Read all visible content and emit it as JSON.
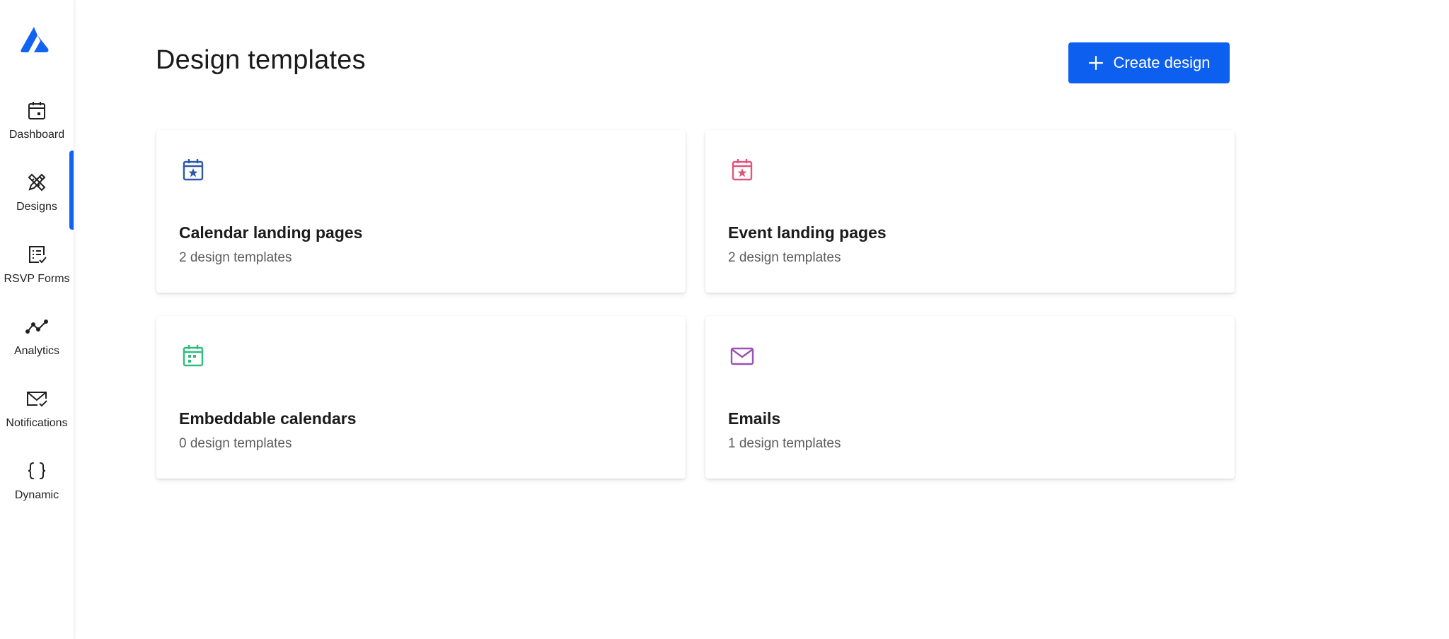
{
  "sidebar": {
    "logo_icon": "brand-logo",
    "active_color": "#1263f1",
    "items": [
      {
        "label": "Dashboard",
        "icon": "calendar-icon"
      },
      {
        "label": "Designs",
        "icon": "design-tools-icon"
      },
      {
        "label": "RSVP Forms",
        "icon": "form-check-icon"
      },
      {
        "label": "Analytics",
        "icon": "line-chart-icon"
      },
      {
        "label": "Notifications",
        "icon": "mail-check-icon"
      },
      {
        "label": "Dynamic",
        "icon": "curly-braces-icon"
      }
    ],
    "active_item": "Designs"
  },
  "header": {
    "title": "Design templates",
    "create_button_label": "Create design",
    "create_button_color": "#0d5ff0"
  },
  "cards": [
    {
      "title": "Calendar landing pages",
      "subtitle": "2 design templates",
      "icon": "calendar-star-icon",
      "icon_color": "#2b5aa8"
    },
    {
      "title": "Event landing pages",
      "subtitle": "2 design templates",
      "icon": "calendar-star-icon",
      "icon_color": "#e0557a"
    },
    {
      "title": "Embeddable calendars",
      "subtitle": "0 design templates",
      "icon": "calendar-grid-icon",
      "icon_color": "#2ebd7f"
    },
    {
      "title": "Emails",
      "subtitle": "1 design templates",
      "icon": "envelope-icon",
      "icon_color": "#9b4fb8"
    }
  ]
}
